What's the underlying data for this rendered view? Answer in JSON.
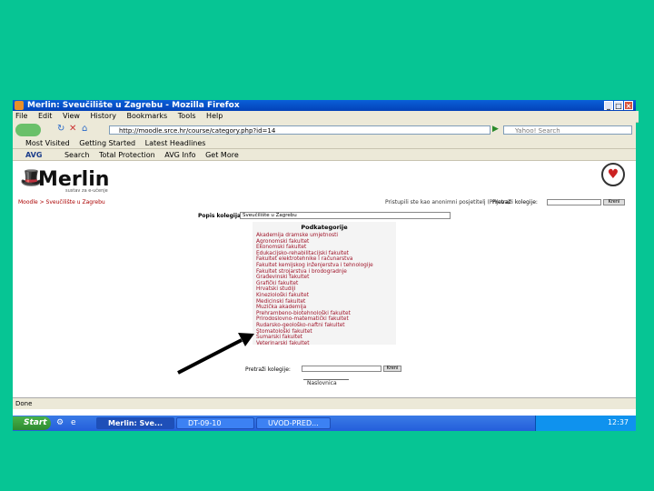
{
  "window": {
    "title": "Merlin: Sveučilište u Zagrebu - Mozilla Firefox"
  },
  "menu": [
    "File",
    "Edit",
    "View",
    "History",
    "Bookmarks",
    "Tools",
    "Help"
  ],
  "nav": {
    "url": "http://moodle.srce.hr/course/category.php?id=14",
    "search_placeholder": "Yahoo! Search"
  },
  "bookmarks": [
    "Most Visited",
    "Getting Started",
    "Latest Headlines"
  ],
  "avg_toolbar": {
    "avg": "AVG",
    "search": "Search",
    "protection": "Total Protection",
    "info": "AVG Info",
    "more": "Get More"
  },
  "page": {
    "logo": "Merlin",
    "logo_sub": "sustav za e-učenje",
    "breadcrumb": "Moodle > Sveučilište u Zagrebu",
    "login_text": "Pristupili ste kao anonimni posjetitelj (Prijava)",
    "search_courses_label": "Pretraži kolegije:",
    "go_label": "Kreni",
    "category_label": "Popis kolegija:",
    "category_selected": "Sveučilište u Zagrebu",
    "subcategories_title": "Podkategorije",
    "subcategories": [
      "Akademija dramske umjetnosti",
      "Agronomski fakultet",
      "Ekonomski fakultet",
      "Edukacijsko-rehabilitacijski fakultet",
      "Fakultet elektrotehnike i računarstva",
      "Fakultet kemijskog inženjerstva i tehnologije",
      "Fakultet strojarstva i brodogradnje",
      "Građevinski fakultet",
      "Grafički fakultet",
      "Hrvatski studiji",
      "Kineziološki fakultet",
      "Medicinski fakultet",
      "Muzička akademija",
      "Prehrambeno-biotehnološki fakultet",
      "Prirodoslovno-matematički fakultet",
      "Rudarsko-geološko-naftni fakultet",
      "Stomatološki fakultet",
      "Šumarski fakultet",
      "Veterinarski fakultet"
    ],
    "search_bottom_label": "Pretraži kolegije:",
    "search_bottom_go": "Kreni",
    "home_link": "Naslovnica"
  },
  "statusbar": "Done",
  "taskbar": {
    "start": "Start",
    "tasks": [
      "Merlin: Sve...",
      "DT-09-10",
      "UVOD-PRED..."
    ],
    "clock": "12:37"
  },
  "colors": {
    "bg": "#06c594",
    "titlebar": "#0a5fd8",
    "link": "#a0152a",
    "arrow": "#000000"
  }
}
